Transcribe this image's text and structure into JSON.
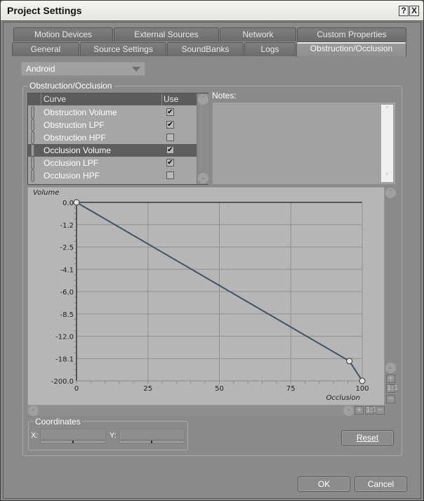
{
  "window": {
    "title": "Project Settings",
    "help_label": "?",
    "close_label": "X"
  },
  "tabs": {
    "row1": [
      {
        "label": "Motion Devices"
      },
      {
        "label": "External Sources"
      },
      {
        "label": "Network"
      },
      {
        "label": "Custom Properties"
      }
    ],
    "row2": [
      {
        "label": "General"
      },
      {
        "label": "Source Settings"
      },
      {
        "label": "SoundBanks"
      },
      {
        "label": "Logs"
      },
      {
        "label": "Obstruction/Occlusion",
        "active": true
      }
    ]
  },
  "platform": {
    "selected": "Android"
  },
  "group": {
    "label": "Obstruction/Occlusion",
    "curve_list": {
      "headers": {
        "curve": "Curve",
        "use": "Use"
      },
      "rows": [
        {
          "name": "Obstruction Volume",
          "use": true,
          "selected": false
        },
        {
          "name": "Obstruction LPF",
          "use": true,
          "selected": false
        },
        {
          "name": "Obstruction HPF",
          "use": false,
          "selected": false
        },
        {
          "name": "Occlusion Volume",
          "use": true,
          "selected": true
        },
        {
          "name": "Occlusion LPF",
          "use": true,
          "selected": false
        },
        {
          "name": "Occlusion HPF",
          "use": false,
          "selected": false
        }
      ]
    },
    "notes": {
      "label": "Notes:",
      "value": ""
    },
    "coordinates": {
      "label": "Coordinates",
      "x_label": "X:",
      "y_label": "Y:",
      "x_value": "-",
      "y_value": "-"
    },
    "reset_label": "Reset"
  },
  "chart_data": {
    "type": "line",
    "title": "",
    "xlabel": "Occlusion",
    "ylabel": "Volume",
    "x_ticks": [
      "0",
      "25",
      "50",
      "75",
      "100"
    ],
    "y_ticks": [
      "0.0",
      "-1.2",
      "-2.5",
      "-4.1",
      "-6.0",
      "-8.5",
      "-12.0",
      "-18.1",
      "-200.0"
    ],
    "xlim": [
      0,
      100
    ],
    "y_scale": "non-linear (dB, labeled positions)",
    "grid": true,
    "series": [
      {
        "name": "Occlusion Volume",
        "color": "#3f5664",
        "points": [
          {
            "x": 0,
            "y": 0.0
          },
          {
            "x": 95.5,
            "y": -39.0
          },
          {
            "x": 100,
            "y": -200.0
          }
        ]
      }
    ]
  },
  "footer": {
    "ok_label": "OK",
    "cancel_label": "Cancel"
  }
}
